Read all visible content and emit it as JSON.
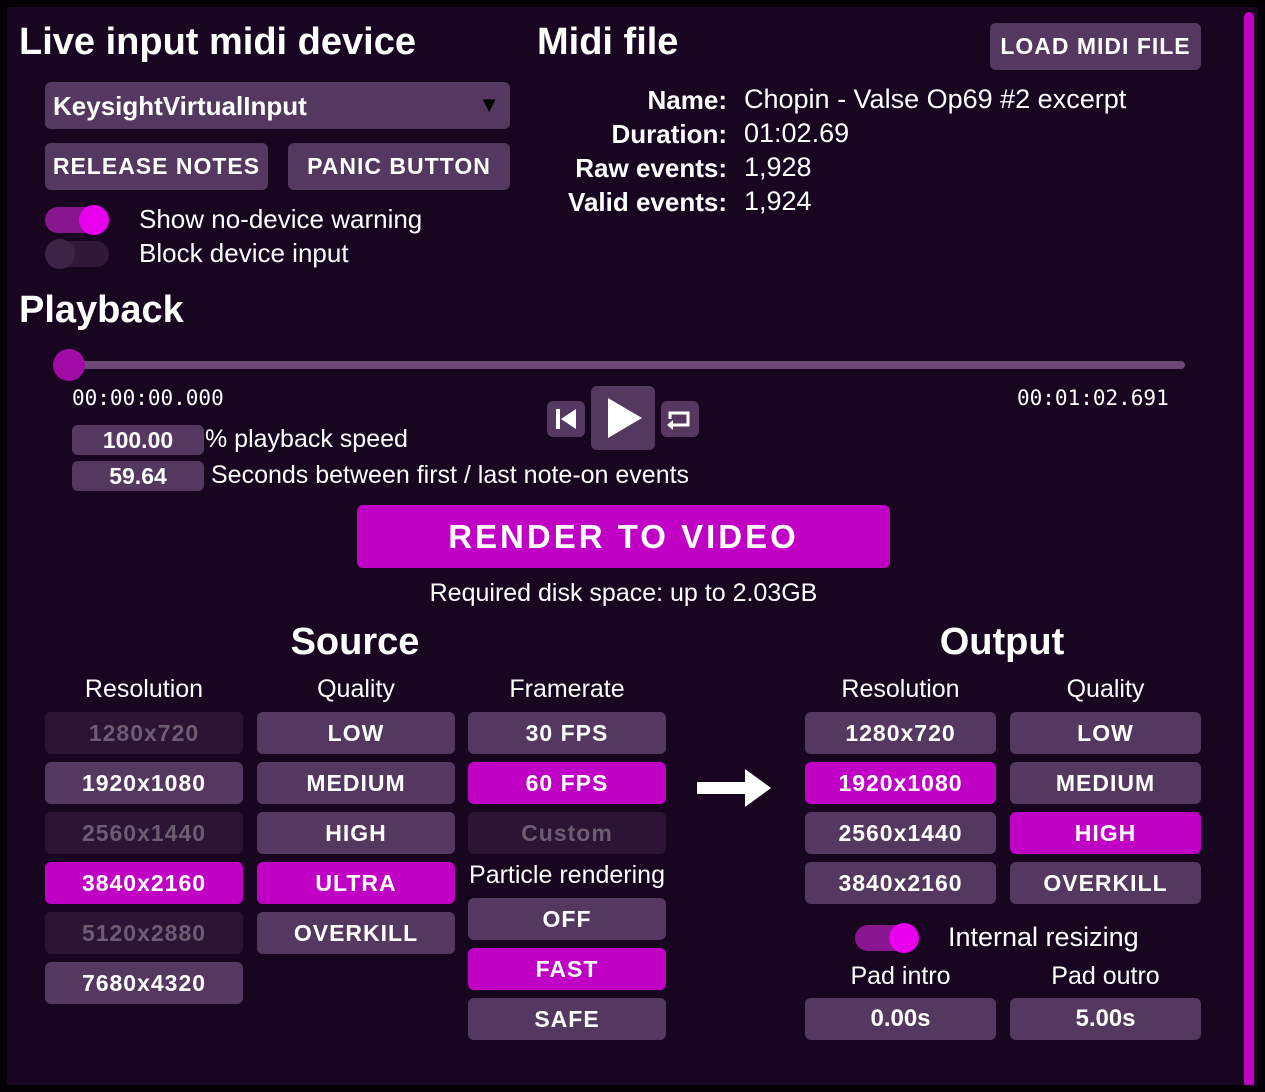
{
  "live_input": {
    "title": "Live input midi device",
    "device_select": "KeysightVirtualInput",
    "release_notes_label": "RELEASE NOTES",
    "panic_label": "PANIC BUTTON",
    "show_warning_label": "Show no-device warning",
    "show_warning_on": true,
    "block_input_label": "Block device input",
    "block_input_on": false
  },
  "midi_file": {
    "title": "Midi file",
    "load_label": "LOAD MIDI FILE",
    "name_key": "Name:",
    "name_value": "Chopin - Valse Op69 #2 excerpt",
    "duration_key": "Duration:",
    "duration_value": "01:02.69",
    "raw_key": "Raw events:",
    "raw_value": "1,928",
    "valid_key": "Valid events:",
    "valid_value": "1,924"
  },
  "playback": {
    "title": "Playback",
    "position_fraction": 0.0,
    "start_time": "00:00:00.000",
    "end_time": "00:01:02.691",
    "speed_value": "100.00",
    "speed_label": "% playback speed",
    "seconds_value": "59.64",
    "seconds_label": "Seconds between first / last note-on events"
  },
  "render": {
    "button_label": "RENDER TO VIDEO",
    "disk_space": "Required disk space: up to 2.03GB"
  },
  "source": {
    "title": "Source",
    "resolution_header": "Resolution",
    "quality_header": "Quality",
    "framerate_header": "Framerate",
    "particle_header": "Particle rendering",
    "resolutions": [
      {
        "label": "1280x720",
        "state": "disabled"
      },
      {
        "label": "1920x1080",
        "state": "normal"
      },
      {
        "label": "2560x1440",
        "state": "disabled"
      },
      {
        "label": "3840x2160",
        "state": "selected"
      },
      {
        "label": "5120x2880",
        "state": "disabled"
      },
      {
        "label": "7680x4320",
        "state": "normal"
      }
    ],
    "qualities": [
      {
        "label": "LOW",
        "state": "normal"
      },
      {
        "label": "MEDIUM",
        "state": "normal"
      },
      {
        "label": "HIGH",
        "state": "normal"
      },
      {
        "label": "ULTRA",
        "state": "selected"
      },
      {
        "label": "OVERKILL",
        "state": "normal"
      }
    ],
    "framerates": [
      {
        "label": "30 FPS",
        "state": "normal"
      },
      {
        "label": "60 FPS",
        "state": "selected"
      },
      {
        "label": "Custom",
        "state": "disabled"
      }
    ],
    "particles": [
      {
        "label": "OFF",
        "state": "normal"
      },
      {
        "label": "FAST",
        "state": "selected"
      },
      {
        "label": "SAFE",
        "state": "normal"
      }
    ]
  },
  "output": {
    "title": "Output",
    "resolution_header": "Resolution",
    "quality_header": "Quality",
    "resolutions": [
      {
        "label": "1280x720",
        "state": "normal"
      },
      {
        "label": "1920x1080",
        "state": "selected"
      },
      {
        "label": "2560x1440",
        "state": "normal"
      },
      {
        "label": "3840x2160",
        "state": "normal"
      }
    ],
    "qualities": [
      {
        "label": "LOW",
        "state": "normal"
      },
      {
        "label": "MEDIUM",
        "state": "normal"
      },
      {
        "label": "HIGH",
        "state": "selected"
      },
      {
        "label": "OVERKILL",
        "state": "normal"
      }
    ],
    "internal_resizing_label": "Internal resizing",
    "internal_resizing_on": true,
    "pad_intro_label": "Pad intro",
    "pad_intro_value": "0.00s",
    "pad_outro_label": "Pad outro",
    "pad_outro_value": "5.00s"
  },
  "colors": {
    "background": "#180620",
    "accent": "#c100c5",
    "button": "#55385f",
    "button_disabled": "#2b1434"
  },
  "icons": {
    "select_arrow": "dropdown-arrow-icon",
    "skip_back": "skip-to-start-icon",
    "play": "play-icon",
    "loop": "loop-icon",
    "arrow": "right-arrow-icon"
  }
}
